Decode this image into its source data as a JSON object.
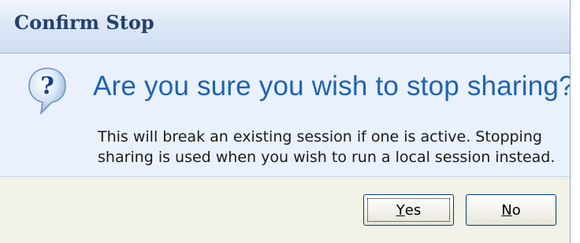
{
  "window": {
    "title": "Confirm Stop"
  },
  "message": {
    "heading": "Are you sure you wish to stop sharing?",
    "body": "This will break an existing session if one is active. Stopping sharing is used when you wish to run a local session instead.",
    "icon": "question-icon"
  },
  "buttons": {
    "yes": {
      "mnemonic": "Y",
      "rest": "es"
    },
    "no": {
      "mnemonic": "N",
      "rest": "o"
    }
  },
  "colors": {
    "heading": "#1f63b3",
    "title": "#24406b",
    "content_bg": "#e9f1fc",
    "button_area_bg": "#f2f1e7"
  }
}
